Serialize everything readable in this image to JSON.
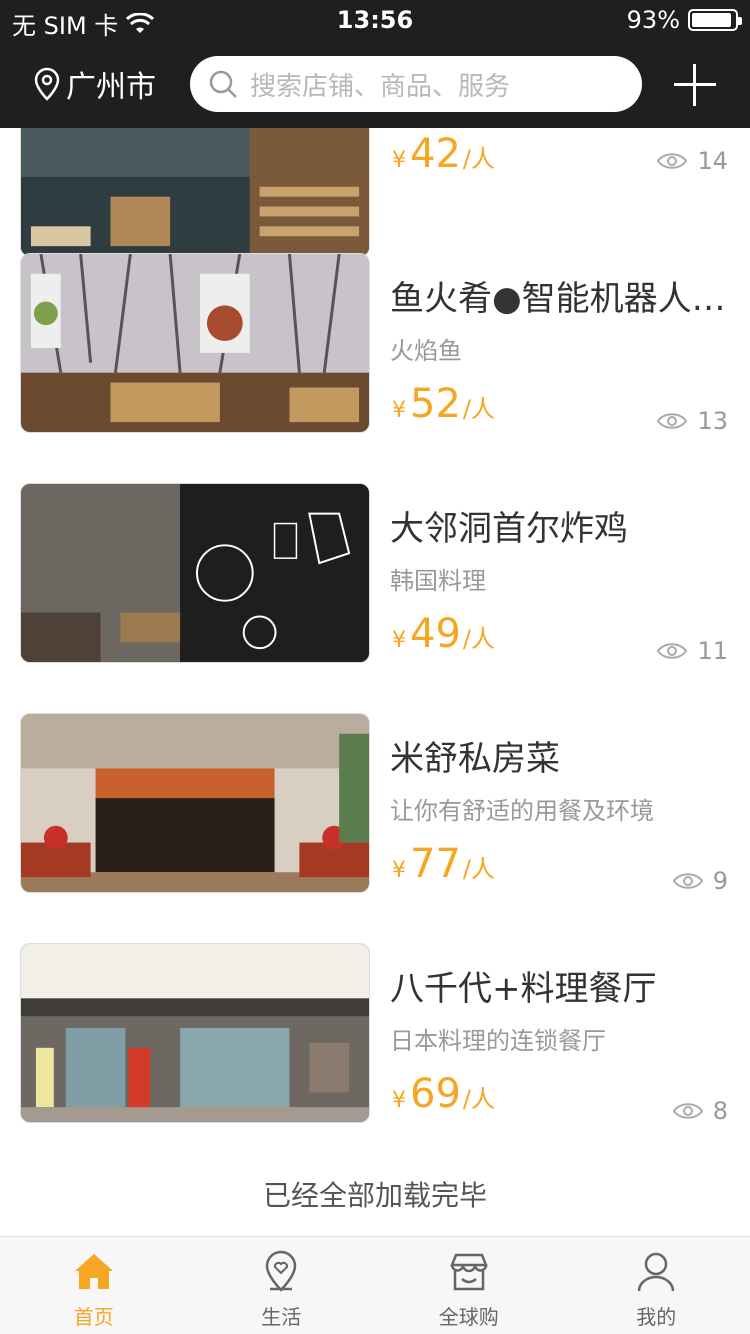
{
  "status_bar": {
    "carrier": "无 SIM 卡",
    "time": "13:56",
    "battery_percent": "93%",
    "battery_level": 0.93
  },
  "navbar": {
    "city": "广州市",
    "search_placeholder": "搜索店铺、商品、服务"
  },
  "restaurants": [
    {
      "name": "",
      "desc": "",
      "currency": "¥",
      "price": "42",
      "unit": "/人",
      "views": "14"
    },
    {
      "name": "鱼火肴●智能机器人餐厅",
      "desc": "火焰鱼",
      "currency": "¥",
      "price": "52",
      "unit": "/人",
      "views": "13"
    },
    {
      "name": "大邻洞首尔炸鸡",
      "desc": "韩国料理",
      "currency": "¥",
      "price": "49",
      "unit": "/人",
      "views": "11"
    },
    {
      "name": "米舒私房菜",
      "desc": "让你有舒适的用餐及环境",
      "currency": "¥",
      "price": "77",
      "unit": "/人",
      "views": "9"
    },
    {
      "name": "八千代+料理餐厅",
      "desc": "日本料理的连锁餐厅",
      "currency": "¥",
      "price": "69",
      "unit": "/人",
      "views": "8"
    }
  ],
  "footer_message": "已经全部加载完毕",
  "tabs": [
    {
      "label": "首页",
      "icon": "home-icon"
    },
    {
      "label": "生活",
      "icon": "location-heart-icon"
    },
    {
      "label": "全球购",
      "icon": "store-icon"
    },
    {
      "label": "我的",
      "icon": "user-icon"
    }
  ],
  "colors": {
    "accent": "#f5a623",
    "nav_bg": "#1f1f1f"
  }
}
